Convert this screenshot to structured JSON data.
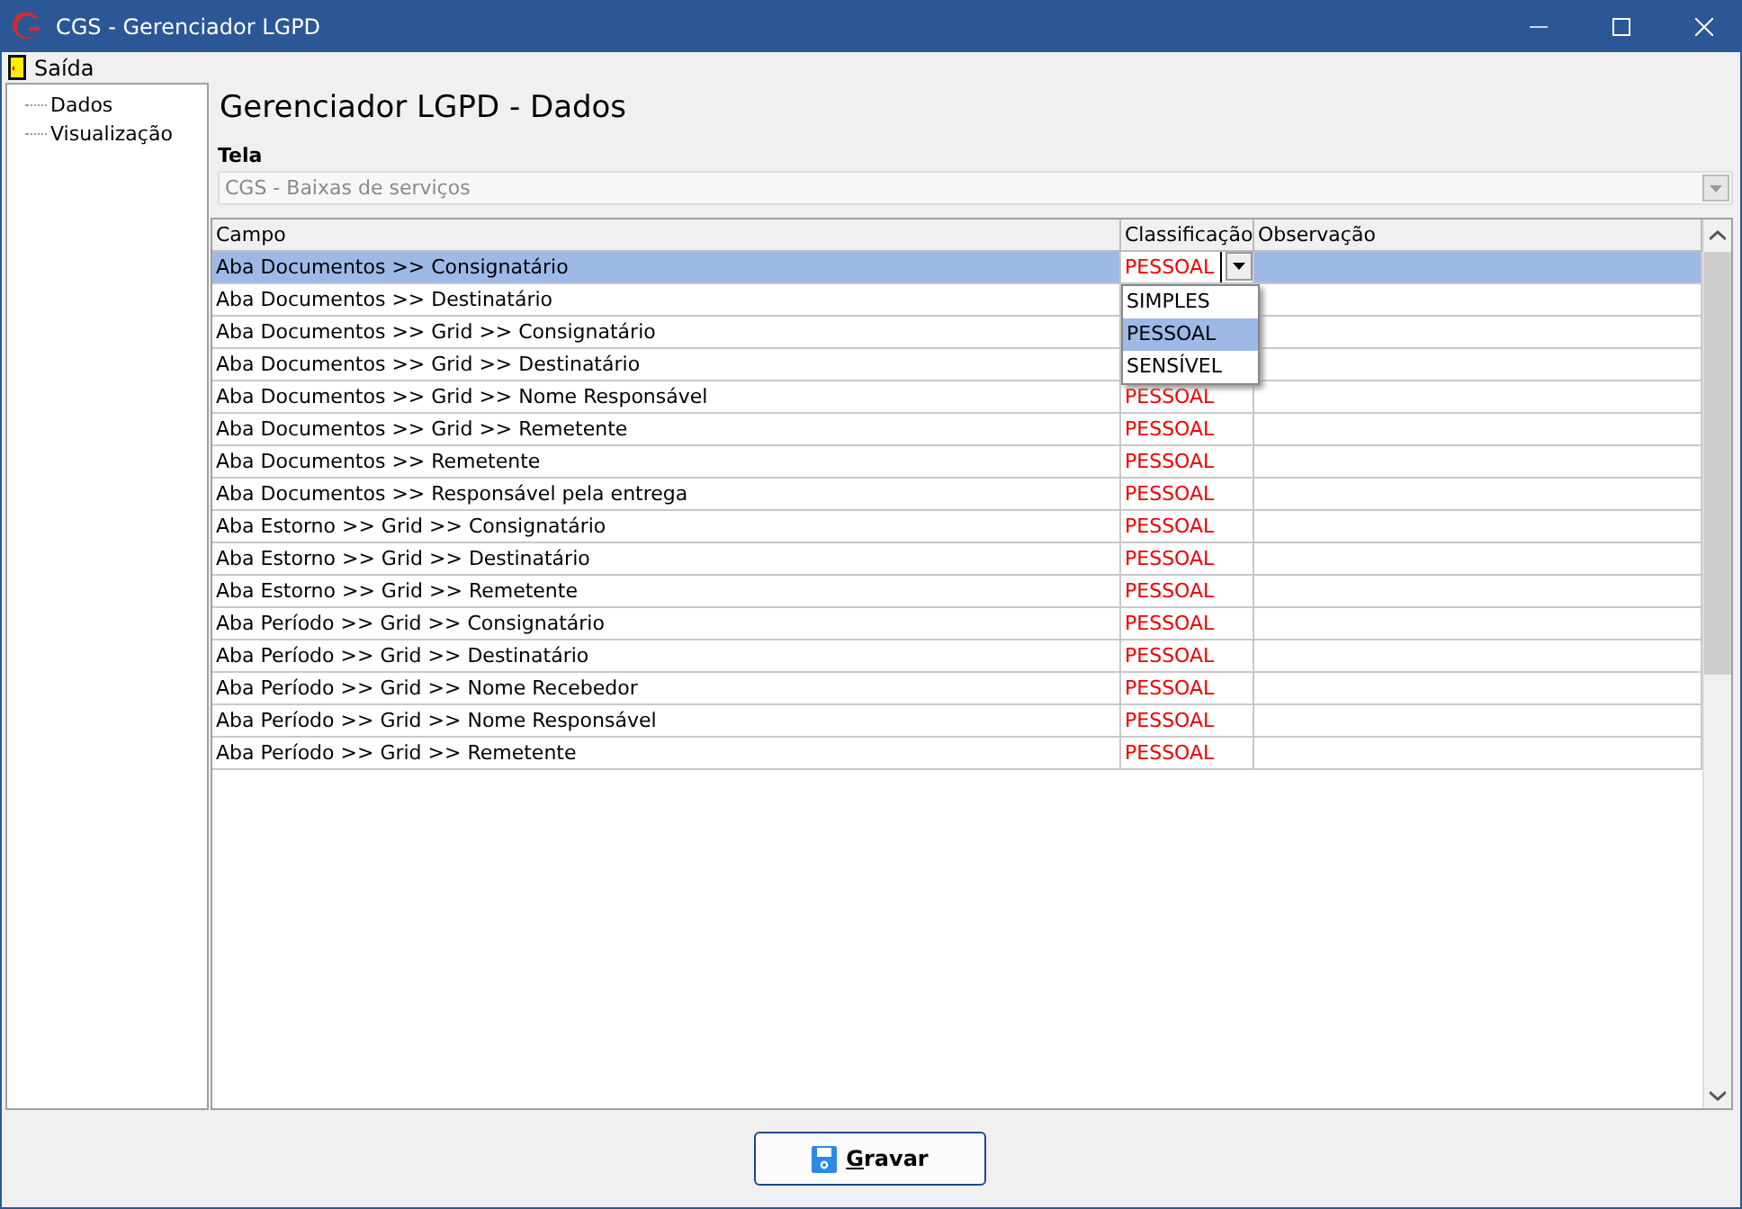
{
  "window": {
    "title": "CGS - Gerenciador LGPD"
  },
  "menu": [
    {
      "label": "Saída"
    }
  ],
  "tree": [
    {
      "label": "Dados"
    },
    {
      "label": "Visualização"
    }
  ],
  "heading": "Gerenciador LGPD - Dados",
  "screen_field": {
    "label": "Tela",
    "value": "CGS - Baixas de serviços",
    "disabled": true
  },
  "table": {
    "columns": [
      "Campo",
      "Classificação",
      "Observação"
    ],
    "rows": [
      {
        "campo": "Aba Documentos >> Consignatário",
        "classificacao": "PESSOAL",
        "selected": true,
        "editing": true
      },
      {
        "campo": "Aba Documentos >> Destinatário",
        "selected": false
      },
      {
        "campo": "Aba Documentos >> Grid >> Consignatário",
        "selected": false
      },
      {
        "campo": "Aba Documentos >> Grid >> Destinatário",
        "selected": false
      },
      {
        "campo": "Aba Documentos >> Grid >> Nome Responsável",
        "classificacao": "PESSOAL",
        "selected": false
      },
      {
        "campo": "Aba Documentos >> Grid >> Remetente",
        "classificacao": "PESSOAL",
        "selected": false
      },
      {
        "campo": "Aba Documentos >> Remetente",
        "classificacao": "PESSOAL",
        "selected": false
      },
      {
        "campo": "Aba Documentos >> Responsável pela entrega",
        "classificacao": "PESSOAL",
        "selected": false
      },
      {
        "campo": "Aba Estorno >> Grid >> Consignatário",
        "classificacao": "PESSOAL",
        "selected": false
      },
      {
        "campo": "Aba Estorno >> Grid >> Destinatário",
        "classificacao": "PESSOAL",
        "selected": false
      },
      {
        "campo": "Aba Estorno >> Grid >> Remetente",
        "classificacao": "PESSOAL",
        "selected": false
      },
      {
        "campo": "Aba Período >> Grid >> Consignatário",
        "classificacao": "PESSOAL",
        "selected": false
      },
      {
        "campo": "Aba Período >> Grid >> Destinatário",
        "classificacao": "PESSOAL",
        "selected": false
      },
      {
        "campo": "Aba Período >> Grid >> Nome Recebedor",
        "classificacao": "PESSOAL",
        "selected": false
      },
      {
        "campo": "Aba Período >> Grid >> Nome Responsável",
        "classificacao": "PESSOAL",
        "selected": false
      },
      {
        "campo": "Aba Período >> Grid >> Remetente",
        "classificacao": "PESSOAL",
        "selected": false
      }
    ]
  },
  "dropdown": {
    "options": [
      {
        "label": "SIMPLES",
        "selected": false
      },
      {
        "label": "PESSOAL",
        "selected": true
      },
      {
        "label": "SENSÍVEL",
        "selected": false
      }
    ]
  },
  "buttons": [
    {
      "label": "Gravar"
    }
  ]
}
